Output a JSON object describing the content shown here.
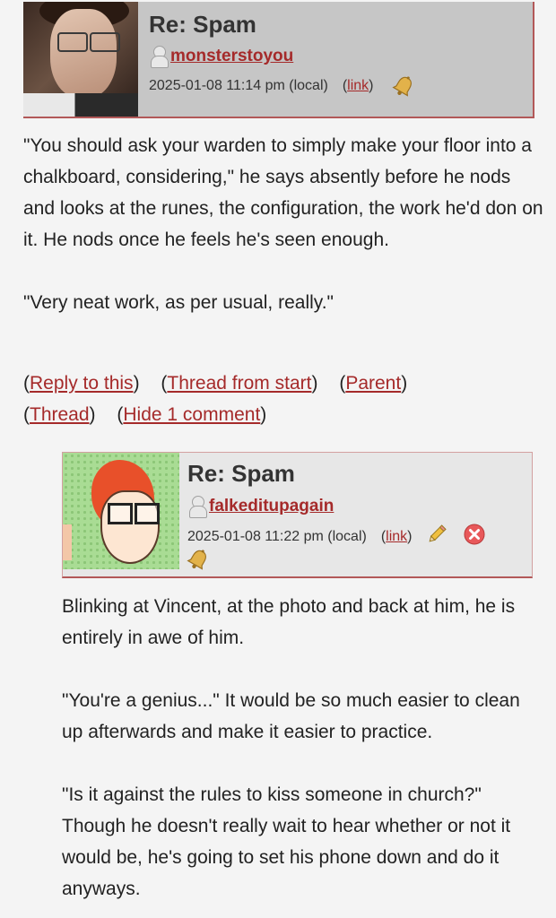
{
  "comment1": {
    "subject": "Re: Spam",
    "username": "monsterstoyou",
    "datetime": "2025-01-08 11:14 pm (local)",
    "link_label": "link",
    "paragraphs": [
      "\"You should ask your warden to simply make your floor into a chalkboard, considering,\" he says absently before he nods and looks at the runes, the configuration, the work he'd don on it. He nods once he feels he's seen enough.",
      "\"Very neat work, as per usual, really.\""
    ],
    "actions": {
      "reply": "Reply to this",
      "thread_from_start": "Thread from start",
      "parent": "Parent",
      "thread": "Thread",
      "hide": "Hide 1 comment"
    }
  },
  "comment2": {
    "subject": "Re: Spam",
    "username": "falkeditupagain",
    "datetime": "2025-01-08 11:22 pm (local)",
    "link_label": "link",
    "paragraphs": [
      "Blinking at Vincent, at the photo and back at him, he is entirely in awe of him.",
      "\"You're a genius...\" It would be so much easier to clean up afterwards and make it easier to practice.",
      "\"Is it against the rules to kiss someone in church?\" Though he doesn't really wait to hear whether or not it would be, he's going to set his phone down and do it anyways."
    ]
  },
  "icons": {
    "user": "user-icon",
    "track": "bell-icon",
    "edit": "pencil-icon",
    "delete": "delete-icon"
  },
  "colors": {
    "link": "#a52a2a",
    "header1_bg": "#c6c6c6",
    "header2_bg": "#e7e7e7",
    "accent_border": "#b25858",
    "page_bg": "#f4f4f4"
  }
}
